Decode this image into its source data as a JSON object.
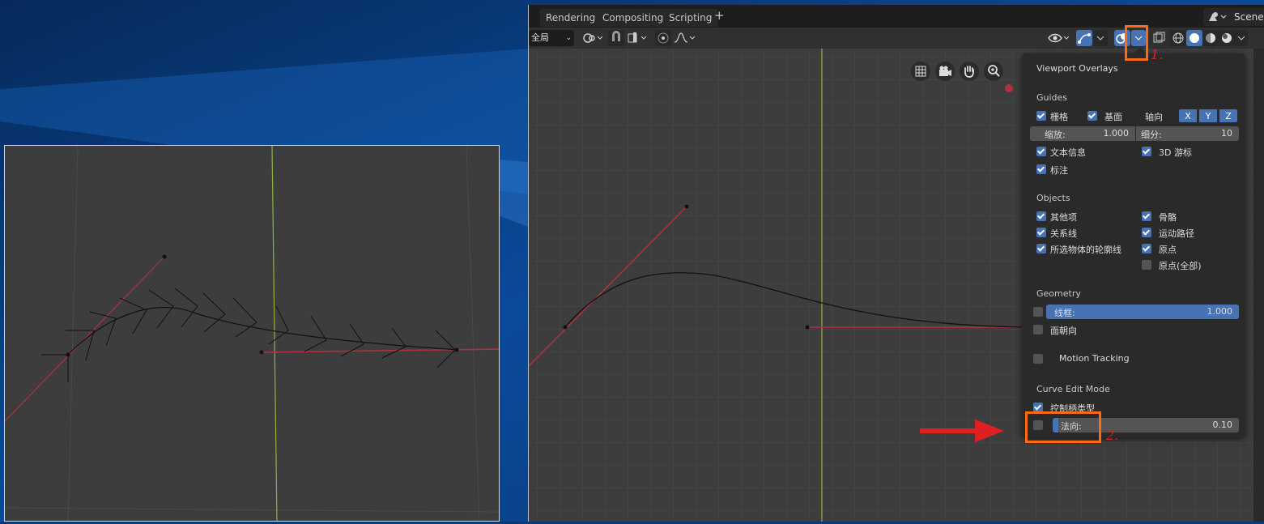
{
  "workspace_tabs": [
    "Rendering",
    "Compositing",
    "Scripting"
  ],
  "tab_add_label": "+",
  "scene_label": "Scene",
  "header": {
    "orientation_value": "全局"
  },
  "overlays": {
    "title": "Viewport Overlays",
    "guides": {
      "heading": "Guides",
      "grid_label": "栅格",
      "floor_label": "基面",
      "axis_label": "轴向",
      "axis_x": "X",
      "axis_y": "Y",
      "axis_z": "Z",
      "scale_label": "缩放:",
      "scale_value": "1.000",
      "subdiv_label": "细分:",
      "subdiv_value": "10",
      "text_info_label": "文本信息",
      "cursor_label": "3D 游标",
      "annotations_label": "标注"
    },
    "objects": {
      "heading": "Objects",
      "extras_label": "其他项",
      "bones_label": "骨骼",
      "relations_label": "关系线",
      "motion_paths_label": "运动路径",
      "outline_label": "所选物体的轮廓线",
      "origins_label": "原点",
      "origins_all_label": "原点(全部)"
    },
    "geometry": {
      "heading": "Geometry",
      "wireframe_label": "线框:",
      "wireframe_value": "1.000",
      "face_orientation_label": "面朝向"
    },
    "motion_tracking_label": "Motion Tracking",
    "curve_edit": {
      "heading": "Curve Edit Mode",
      "handles_label": "控制柄类型",
      "normals_label": "法向:",
      "normals_value": "0.10",
      "normals_fraction": 0.03
    }
  },
  "annotations": {
    "one": "1.",
    "two": "2."
  },
  "colors": {
    "accent": "#4772b3",
    "highlight_box": "#ff6a13",
    "arrow": "#e02020",
    "curve_handle": "#b03040",
    "y_axis": "#8cb43c"
  }
}
